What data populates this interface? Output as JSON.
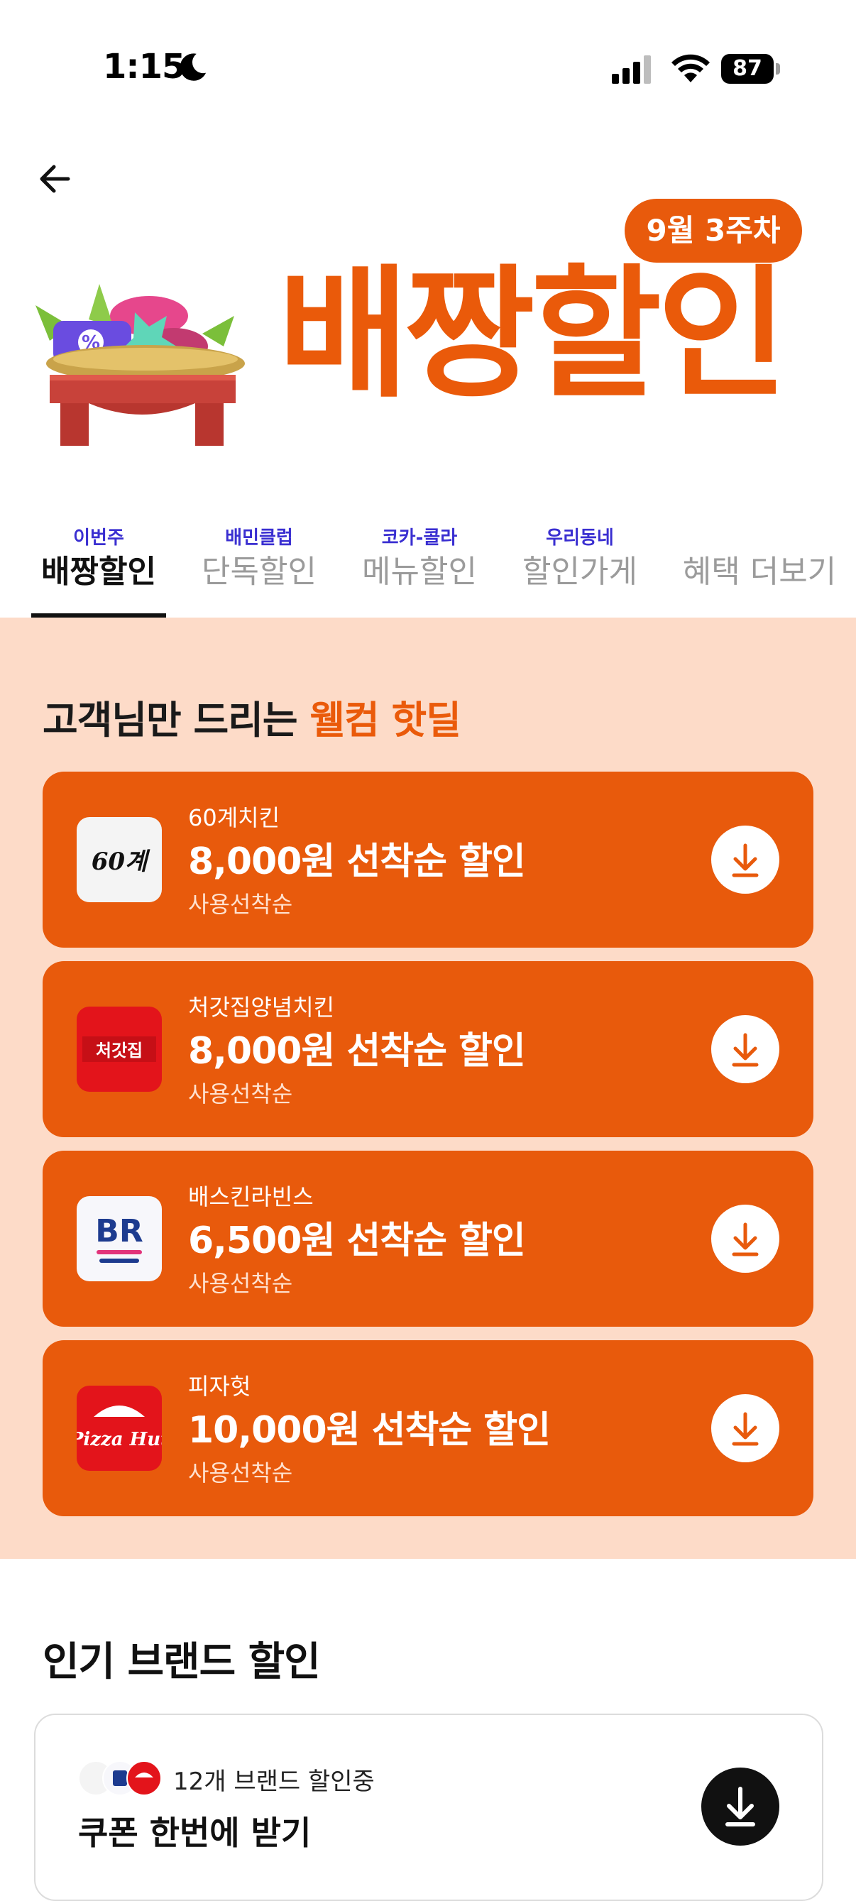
{
  "status_bar": {
    "time": "1:15",
    "battery": "87"
  },
  "hero": {
    "week_badge": "9월 3주차",
    "title": "배짱할인"
  },
  "tabs": [
    {
      "sub": "이번주",
      "label": "배짱할인",
      "active": true
    },
    {
      "sub": "배민클럽",
      "label": "단독할인",
      "active": false
    },
    {
      "sub": "코카-콜라",
      "label": "메뉴할인",
      "active": false
    },
    {
      "sub": "우리동네",
      "label": "할인가게",
      "active": false
    },
    {
      "sub": "",
      "label": "혜택 더보기",
      "active": false
    }
  ],
  "welcome": {
    "title_prefix": "고객님만 드리는 ",
    "title_highlight": "웰컴 핫딜",
    "coupons": [
      {
        "brand": "60계치킨",
        "amount": "8,000원 선착순 할인",
        "note": "사용선착순",
        "logo_text": "60계"
      },
      {
        "brand": "처갓집양념치킨",
        "amount": "8,000원 선착순 할인",
        "note": "사용선착순",
        "logo_text": "처갓집"
      },
      {
        "brand": "배스킨라빈스",
        "amount": "6,500원 선착순 할인",
        "note": "사용선착순",
        "logo_text": "BR"
      },
      {
        "brand": "피자헛",
        "amount": "10,000원 선착순 할인",
        "note": "사용선착순",
        "logo_text": "Pizza Hut"
      }
    ]
  },
  "popular": {
    "title": "인기 브랜드 할인",
    "bundle_count": "12개 브랜드 할인중",
    "bundle_cta": "쿠폰 한번에 받기"
  },
  "colors": {
    "accent": "#e85a0c",
    "welcome_bg": "#fddbc8",
    "tab_sub": "#3a2fd1"
  }
}
